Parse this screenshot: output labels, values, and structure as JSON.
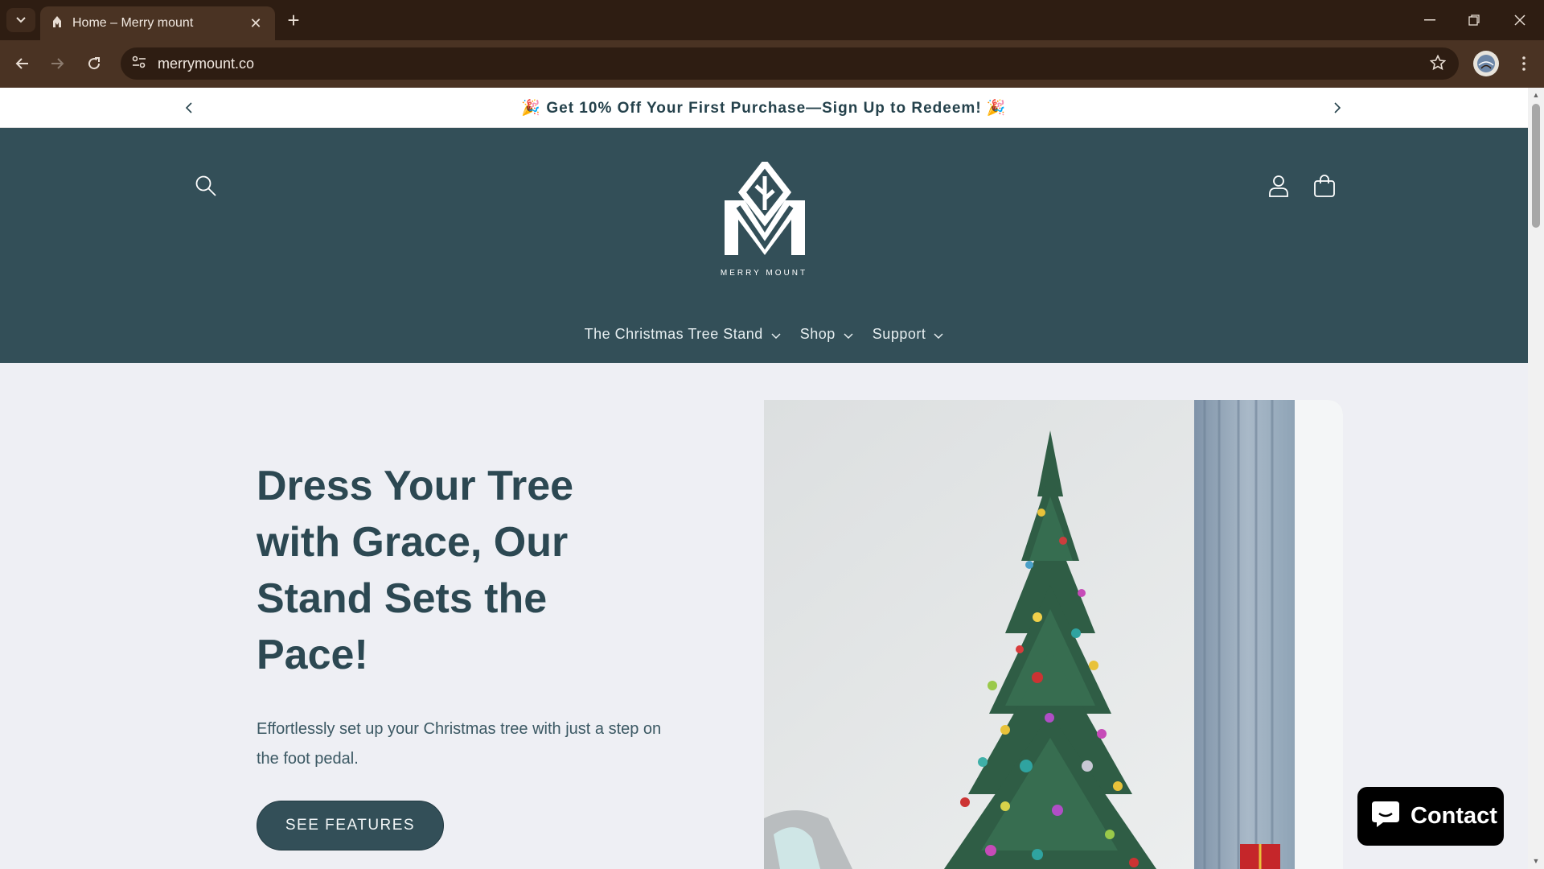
{
  "browser": {
    "tab_title": "Home – Merry mount",
    "url": "merrymount.co",
    "icons": [
      "tab-list-icon",
      "tab-favicon",
      "close-icon",
      "new-tab-icon",
      "minimize-icon",
      "restore-icon",
      "window-close-icon",
      "back-icon",
      "forward-icon",
      "reload-icon",
      "site-info-icon",
      "bookmark-star-icon",
      "profile-avatar-icon",
      "more-menu-icon"
    ]
  },
  "announcement": {
    "text": "🎉 Get 10% Off Your First Purchase—Sign Up to Redeem! 🎉"
  },
  "header": {
    "logo_text": "MERRY MOUNT",
    "menu": [
      {
        "label": "The Christmas Tree Stand"
      },
      {
        "label": "Shop"
      },
      {
        "label": "Support"
      }
    ]
  },
  "hero": {
    "title": "Dress Your Tree with Grace, Our Stand Sets the Pace!",
    "subtitle": "Effortlessly set up your Christmas tree with just a step on the foot pedal.",
    "button_label": "SEE FEATURES"
  },
  "chat": {
    "label": "Contact"
  },
  "colors": {
    "browser_dark": "#2e1d12",
    "browser_toolbar": "#4a3323",
    "header_teal": "#334f58",
    "hero_bg": "#eeeff4",
    "heading_text": "#2c4852"
  }
}
